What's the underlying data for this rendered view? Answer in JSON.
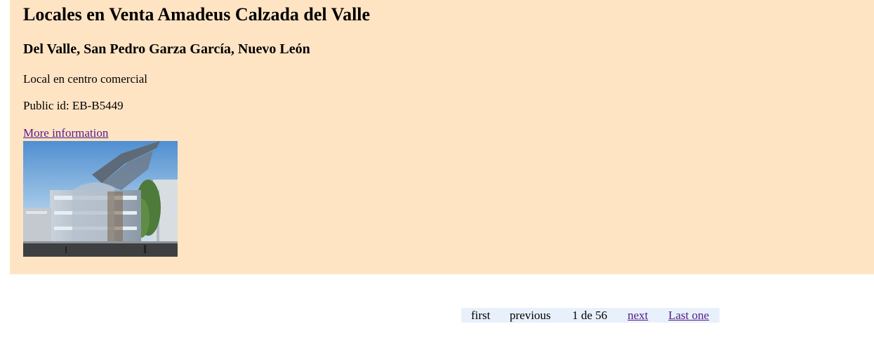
{
  "listing": {
    "title": "Locales en Venta Amadeus Calzada del Valle",
    "location": "Del Valle, San Pedro Garza García, Nuevo León",
    "type": "Local en centro comercial",
    "public_id": "Public id: EB-B5449",
    "link_label": "More information",
    "background_color": "#ffe4c4"
  },
  "pagination": {
    "first": "first",
    "previous": "previous",
    "count": "1 de 56",
    "next": "next",
    "last": "Last one",
    "link_color": "#551a8b"
  }
}
